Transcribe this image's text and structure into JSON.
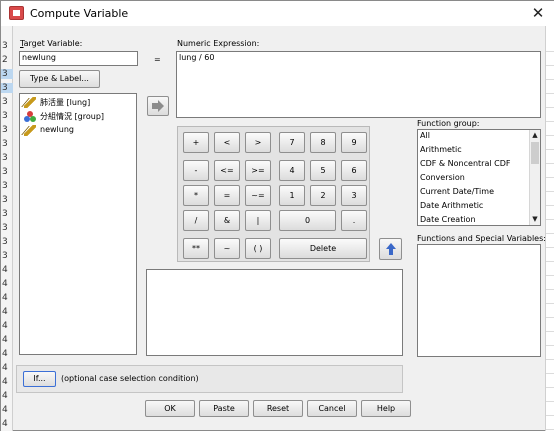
{
  "window": {
    "title": "Compute Variable",
    "close_glyph": "✕"
  },
  "labels": {
    "target_variable": "Target Variable:",
    "equals": "=",
    "numeric_expression": "Numeric Expression:",
    "function_group": "Function group:",
    "functions_special": "Functions and Special Variables:",
    "if_hint": "(optional case selection condition)"
  },
  "target_variable": {
    "value": "newlung"
  },
  "numeric_expression": {
    "value": "lung / 60"
  },
  "type_label_button": "Type & Label...",
  "variables": [
    {
      "label": "肺活量 [lung]",
      "icon": "scale-ruler-icon"
    },
    {
      "label": "分組情況 [group]",
      "icon": "nominal-group-icon"
    },
    {
      "label": "newlung",
      "icon": "scale-ruler-icon"
    }
  ],
  "keypad": {
    "row1": [
      "+",
      "<",
      ">",
      "7",
      "8",
      "9"
    ],
    "row2": [
      "-",
      "<=",
      ">=",
      "4",
      "5",
      "6"
    ],
    "row3": [
      "*",
      "=",
      "~=",
      "1",
      "2",
      "3"
    ],
    "row4": [
      "/",
      "&",
      "|",
      "0",
      "."
    ],
    "row5": [
      "**",
      "~",
      "( )",
      "Delete"
    ]
  },
  "function_groups": [
    "All",
    "Arithmetic",
    "CDF & Noncentral CDF",
    "Conversion",
    "Current Date/Time",
    "Date Arithmetic",
    "Date Creation"
  ],
  "buttons": {
    "if": "If...",
    "ok": "OK",
    "paste": "Paste",
    "reset": "Reset",
    "cancel": "Cancel",
    "help": "Help"
  },
  "background_rows": [
    "3",
    "2",
    "3",
    "3",
    "3",
    "3",
    "3",
    "3",
    "3",
    "3",
    "3",
    "3",
    "3",
    "3",
    "3",
    "3",
    "4",
    "4",
    "4",
    "4",
    "4",
    "4",
    "4",
    "4",
    "4",
    "4",
    "4",
    "4"
  ],
  "colors": {
    "accent": "#3a68c8",
    "selection": "#bcd7f0"
  }
}
